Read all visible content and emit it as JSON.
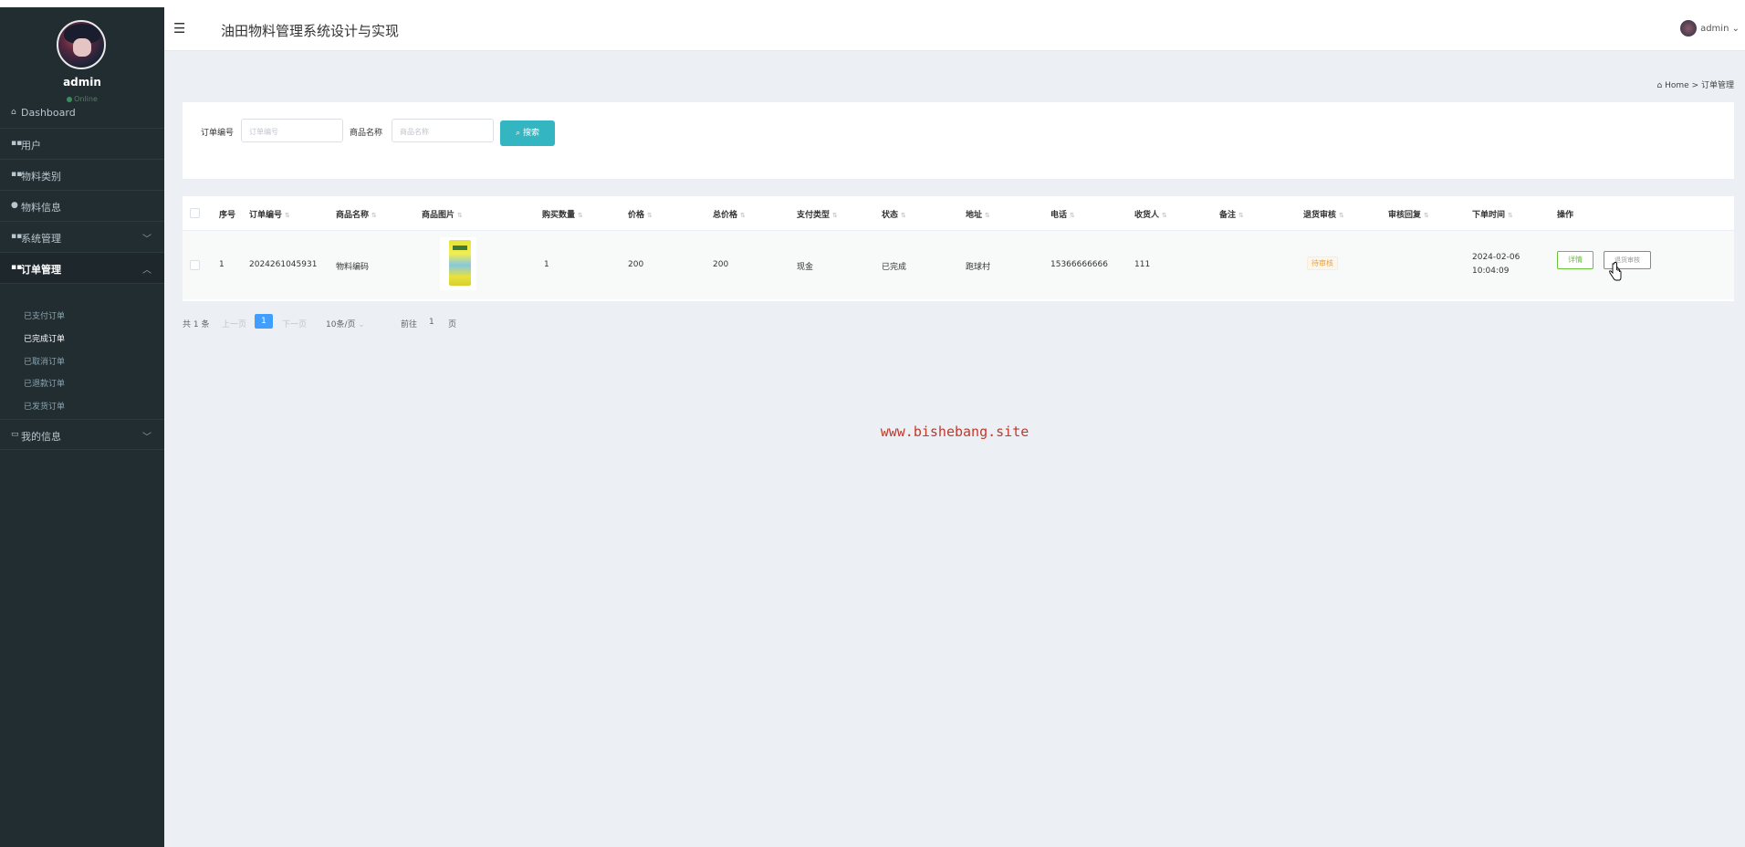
{
  "sidebar": {
    "username": "admin",
    "status": "Online",
    "items": [
      {
        "icon": "home-icon",
        "label": "Dashboard"
      },
      {
        "icon": "grid-icon",
        "label": "用户"
      },
      {
        "icon": "grid-icon",
        "label": "物料类别"
      },
      {
        "icon": "user-icon",
        "label": "物料信息"
      },
      {
        "icon": "grid-icon",
        "label": "系统管理"
      },
      {
        "icon": "grid-icon",
        "label": "订单管理"
      },
      {
        "icon": "card-icon",
        "label": "我的信息"
      }
    ],
    "order_subitems": [
      "已支付订单",
      "已完成订单",
      "已取消订单",
      "已退款订单",
      "已发货订单"
    ]
  },
  "header": {
    "title": "油田物料管理系统设计与实现",
    "user": "admin"
  },
  "breadcrumb": {
    "home": "Home",
    "separator": ">",
    "current": "订单管理"
  },
  "search": {
    "order_label": "订单编号",
    "order_placeholder": "订单编号",
    "product_label": "商品名称",
    "product_placeholder": "商品名称",
    "button": "搜索"
  },
  "table": {
    "columns": [
      "序号",
      "订单编号",
      "商品名称",
      "商品图片",
      "购买数量",
      "价格",
      "总价格",
      "支付类型",
      "状态",
      "地址",
      "电话",
      "收货人",
      "备注",
      "退货审核",
      "审核回复",
      "下单时间",
      "操作"
    ],
    "rows": [
      {
        "index": "1",
        "order_no": "2024261045931",
        "product_name": "物料编码",
        "quantity": "1",
        "price": "200",
        "total": "200",
        "pay_type": "现金",
        "status": "已完成",
        "address": "跑球村",
        "phone": "15366666666",
        "receiver": "111",
        "remark": "",
        "return_review": "待审核",
        "review_reply": "",
        "order_time": "2024-02-06 10:04:09",
        "detail_button": "详情",
        "review_button": "退货审核"
      }
    ]
  },
  "pagination": {
    "total": "共 1 条",
    "prev": "上一页",
    "current": "1",
    "next": "下一页",
    "page_size": "10条/页",
    "goto_label": "前往",
    "goto_value": "1",
    "page_unit": "页"
  },
  "watermark": "www.bishebang.site",
  "colors": {
    "sidebar_bg": "#222d32",
    "search_button": "#33b6c1",
    "page_active": "#409eff",
    "detail_green": "#67c23a",
    "warning_orange": "#e6a23c",
    "watermark_red": "#c0392b"
  }
}
